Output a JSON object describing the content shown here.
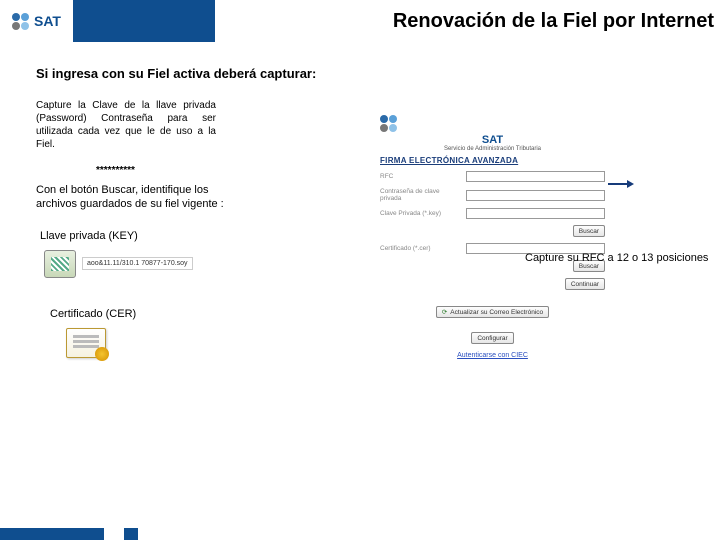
{
  "header": {
    "logo_text": "SAT",
    "title": "Renovación de la Fiel por Internet"
  },
  "left": {
    "subtitle": "Si ingresa con su Fiel activa deberá capturar:",
    "para1": "Capture la Clave de la llave privada (Password) Contraseña para ser utilizada cada vez que le de uso a la Fiel.",
    "asterisks": "**********",
    "para2": "Con el botón Buscar, identifique los archivos guardados de su fiel vigente :",
    "key_label": "Llave privada (KEY)",
    "key_filename": "aoo&11.11/310.1\n70877-170.soy",
    "cer_label": "Certificado (CER)"
  },
  "right": {
    "rfc_note": "Capture su RFC a 12 o 13 posiciones"
  },
  "panel": {
    "caption": "Servicio de Administración Tributaria",
    "banner": "FIRMA ELECTRÓNICA AVANZADA",
    "labels": {
      "rfc": "RFC",
      "password": "Contraseña de clave privada",
      "private_key": "Clave Privada (*.key)",
      "certificate": "Certificado (*.cer)"
    },
    "buttons": {
      "buscar": "Buscar",
      "continuar": "Continuar",
      "update": "Actualizar su Correo Electrónico",
      "configurar": "Configurar"
    },
    "link": "Autenticarse con CIEC"
  }
}
